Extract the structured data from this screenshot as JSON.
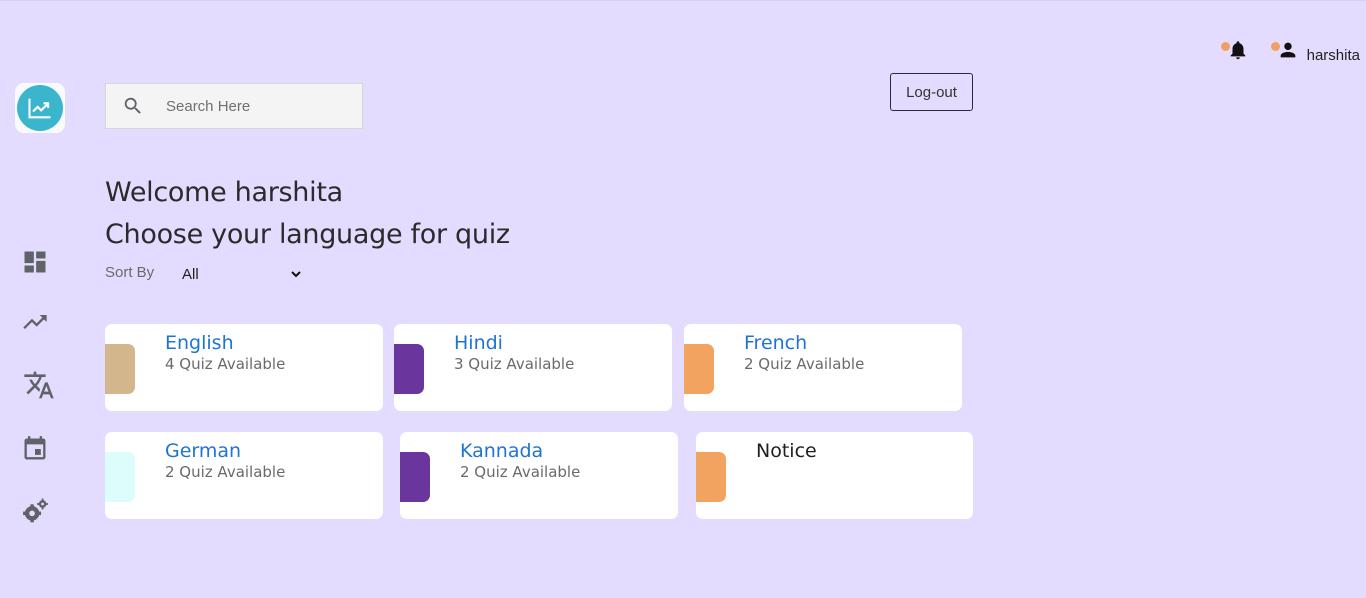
{
  "header": {
    "username": "harshita",
    "notification_dot_color": "#f0a060"
  },
  "sidebar": {
    "logo_icon": "trending-chart-icon",
    "logo_color": "#3bb5cc",
    "items": [
      {
        "icon": "dashboard-icon"
      },
      {
        "icon": "trending-up-icon"
      },
      {
        "icon": "translate-icon"
      },
      {
        "icon": "calendar-icon"
      },
      {
        "icon": "settings-gears-icon"
      }
    ]
  },
  "search": {
    "placeholder": "Search Here",
    "value": ""
  },
  "logout_label": "Log-out",
  "welcome": "Welcome harshita",
  "prompt": "Choose your language for quiz",
  "sort": {
    "label": "Sort By",
    "selected": "All"
  },
  "cards": [
    {
      "title": "English",
      "subtitle": "4 Quiz Available",
      "accent": "#d4b68c"
    },
    {
      "title": "Hindi",
      "subtitle": "3 Quiz Available",
      "accent": "#6b359e"
    },
    {
      "title": "French",
      "subtitle": "2 Quiz Available",
      "accent": "#f3a360"
    },
    {
      "title": "German",
      "subtitle": "2 Quiz Available",
      "accent": "#dcfdfb"
    },
    {
      "title": "Kannada",
      "subtitle": "2 Quiz Available",
      "accent": "#6b359e"
    },
    {
      "title": "Notice",
      "subtitle": "",
      "accent": "#f3a360"
    }
  ]
}
